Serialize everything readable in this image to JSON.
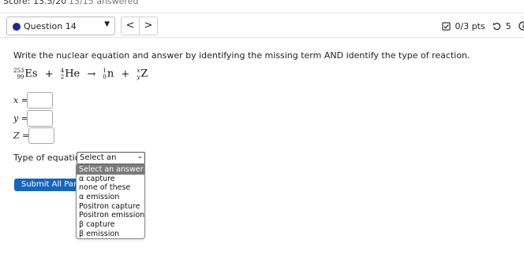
{
  "header": {
    "score": "Score: 13.5/20",
    "answered": "13/15 answered"
  },
  "nav": {
    "question_label": "Question 14",
    "prev_symbol": "<",
    "next_symbol": ">",
    "points": "0/3 pts",
    "tries": "5",
    "details_partial": "De"
  },
  "question": {
    "prompt": "Write the nuclear equation and answer by identifying the missing term AND identify the type of reaction.",
    "equation": {
      "term1": {
        "mass": "253",
        "atomic": "99",
        "symbol": "Es"
      },
      "plus": "+",
      "term2": {
        "mass": "4",
        "atomic": "2",
        "symbol": "He"
      },
      "arrow": "→",
      "term3": {
        "mass": "1",
        "atomic": "0",
        "symbol": "n"
      },
      "term4": {
        "mass": "x",
        "atomic": "y",
        "symbol": "Z"
      }
    },
    "inputs": [
      {
        "label": "x =",
        "value": ""
      },
      {
        "label": "y =",
        "value": ""
      },
      {
        "label": "Z =",
        "value": ""
      }
    ],
    "type_label": "Type of equation",
    "type_select_value": "Select an answer",
    "type_options": [
      "Select an answer",
      "α capture",
      "none of these",
      "α emission",
      "Positron capture",
      "Positron emission",
      "β capture",
      "β emission"
    ],
    "submit_label": "Submit All Parts"
  },
  "colors": {
    "accent": "#1565c0",
    "question_dot": "#1a2b8a",
    "selected_option_bg": "#7a7a7a"
  }
}
